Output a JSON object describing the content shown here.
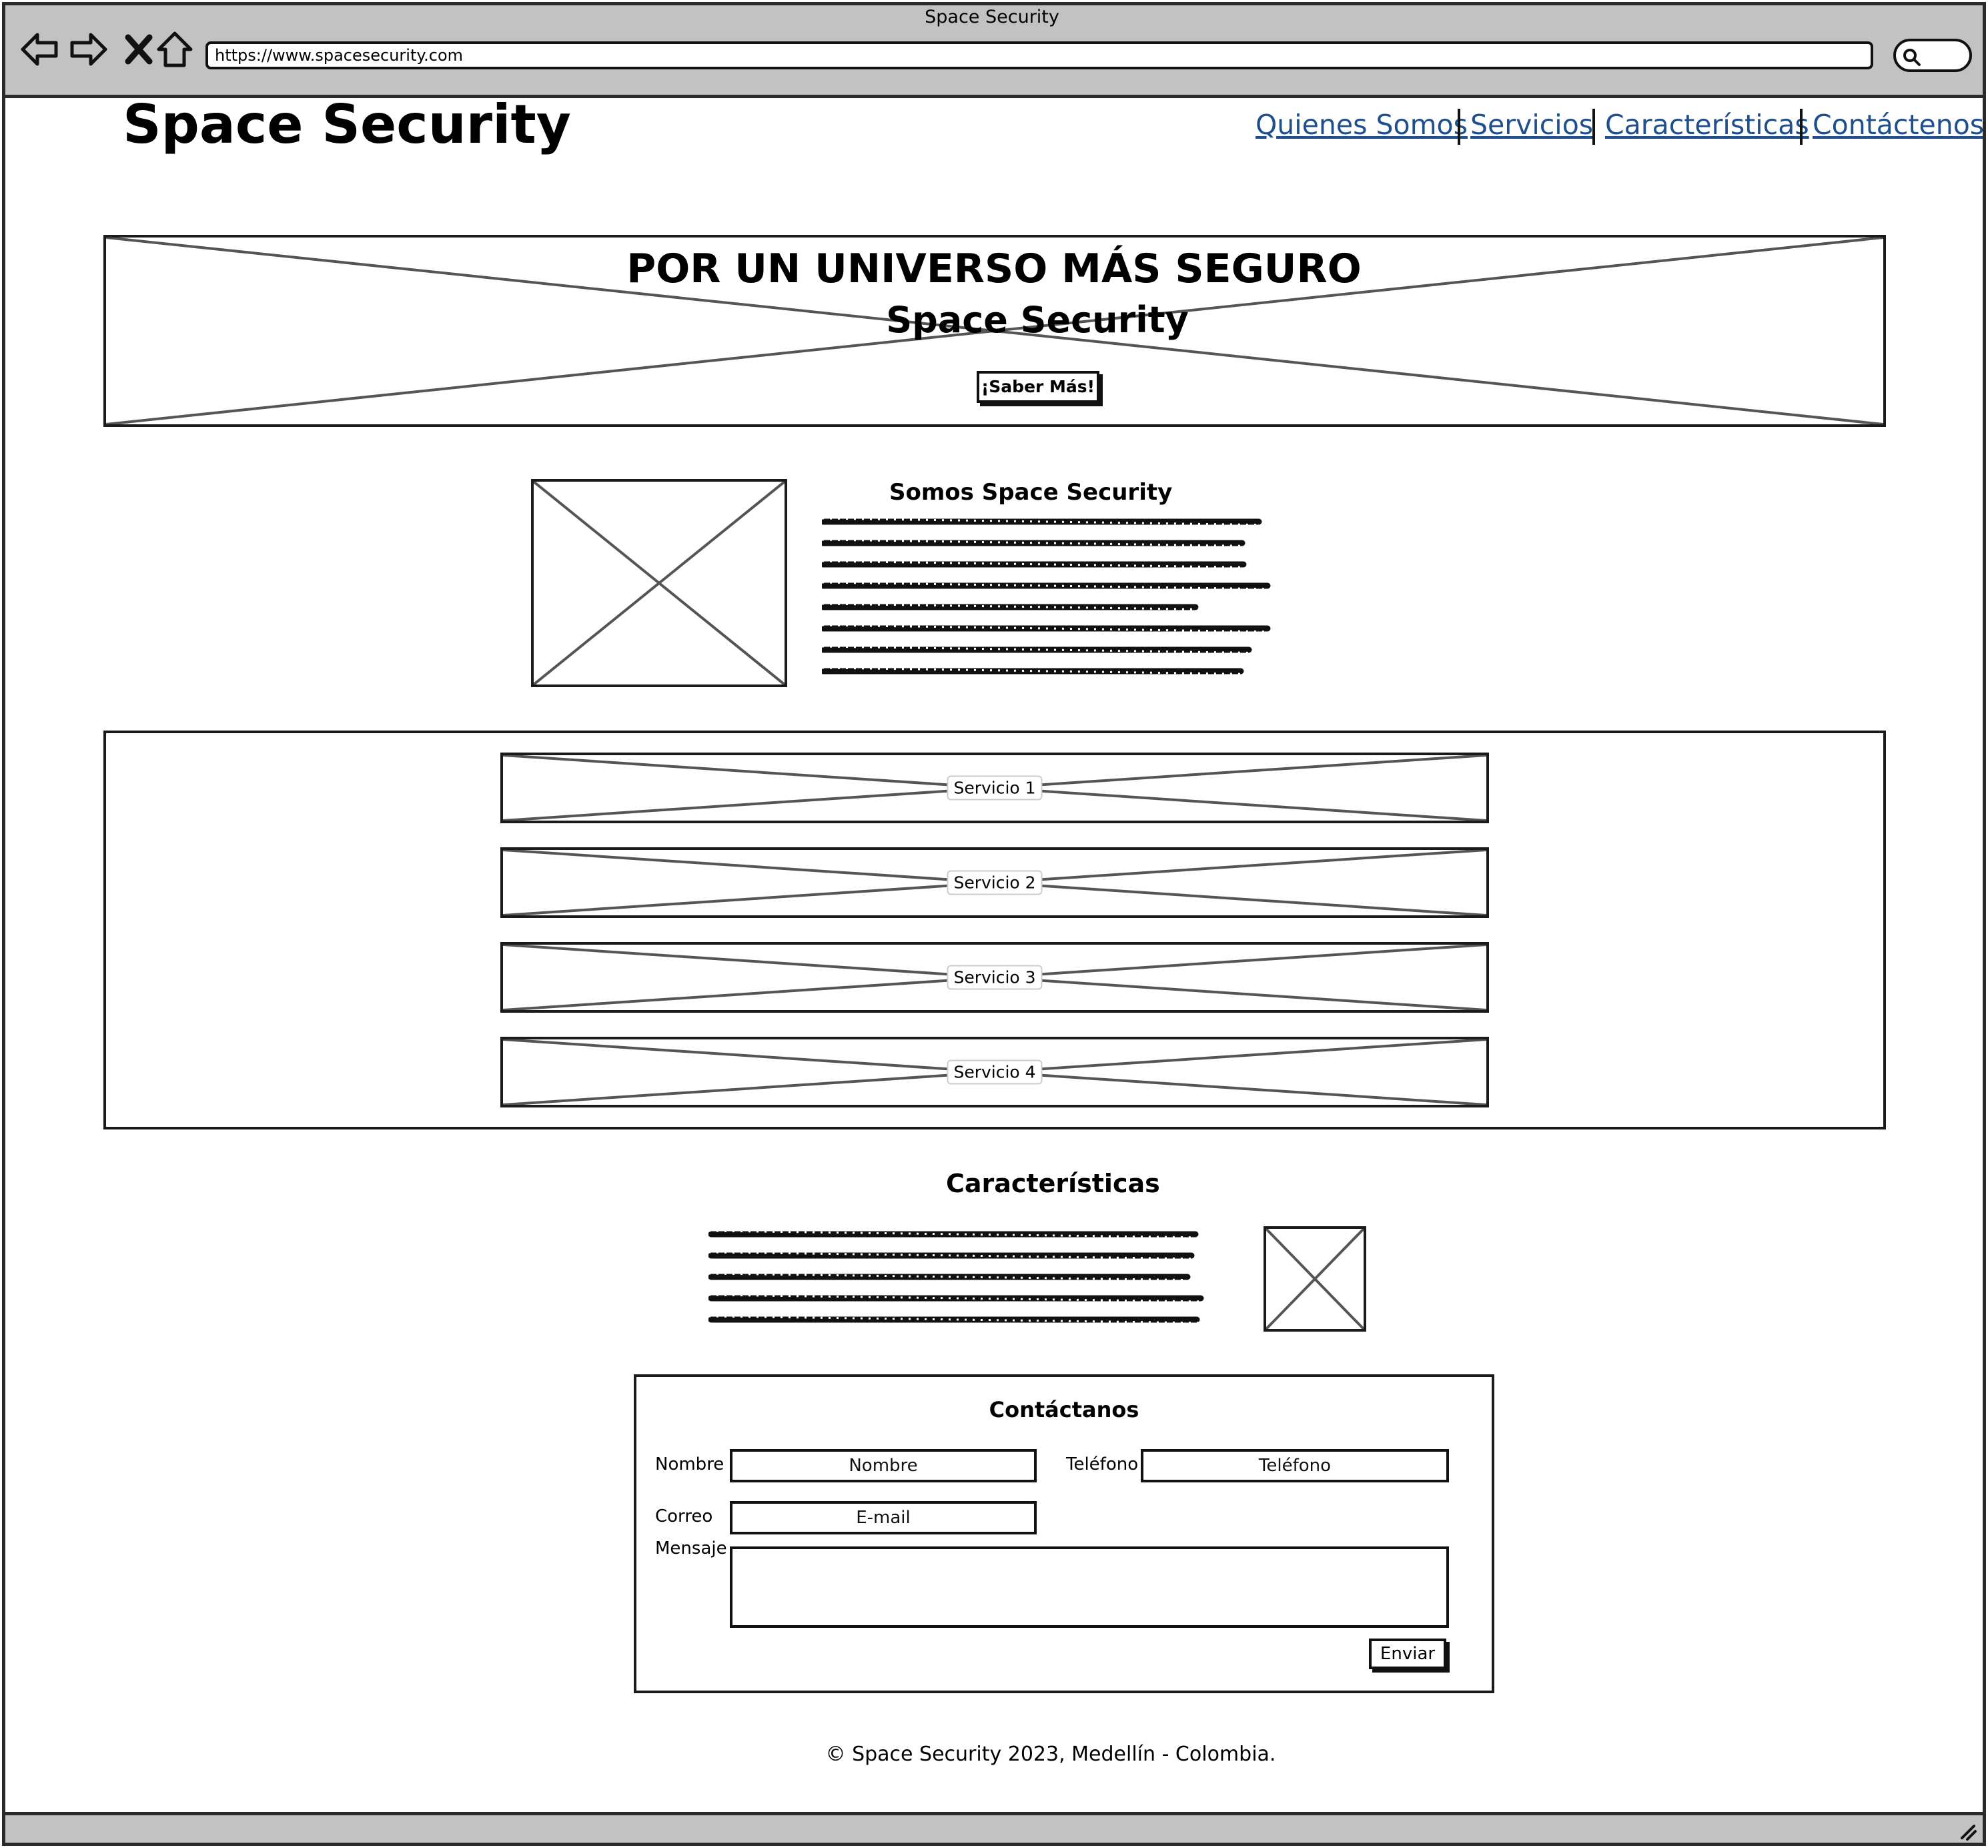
{
  "window": {
    "title": "Space Security",
    "url": "https://www.spacesecurity.com"
  },
  "icons": [
    "back-icon",
    "forward-icon",
    "close-icon",
    "home-icon",
    "search-icon",
    "resize-grip-icon"
  ],
  "header": {
    "site_title": "Space Security",
    "nav": [
      "Quienes Somos",
      "Servicios",
      "Características",
      "Contáctenos"
    ]
  },
  "hero": {
    "title": "POR UN UNIVERSO MÁS SEGURO",
    "subtitle": "Space Security",
    "button": "¡Saber Más!"
  },
  "about": {
    "heading": "Somos Space Security"
  },
  "services": [
    "Servicio 1",
    "Servicio 2",
    "Servicio 3",
    "Servicio 4"
  ],
  "features": {
    "heading": "Características"
  },
  "contact": {
    "heading": "Contáctanos",
    "name_label": "Nombre",
    "name_placeholder": "Nombre",
    "phone_label": "Teléfono",
    "phone_placeholder": "Teléfono",
    "email_label": "Correo",
    "email_placeholder": "E-mail",
    "message_label": "Mensaje",
    "send_button": "Enviar"
  },
  "footer": {
    "text": "© Space Security 2023, Medellín - Colombia."
  }
}
